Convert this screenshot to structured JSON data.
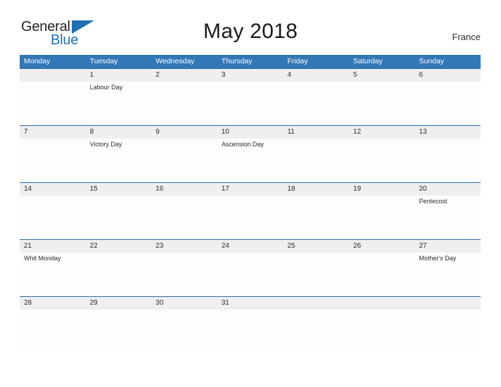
{
  "branding": {
    "name_part1": "General",
    "name_part2": "Blue",
    "flag_icon": "blue-triangle-flag-icon"
  },
  "header": {
    "title": "May 2018",
    "country": "France"
  },
  "colors": {
    "header_blue": "#3277b6",
    "rule_blue": "#2f6da8",
    "date_band_gray": "#efefef",
    "logo_blue": "#1f6fb2",
    "text_dark": "#2b2b2b"
  },
  "calendar": {
    "weekdays": [
      "Monday",
      "Tuesday",
      "Wednesday",
      "Thursday",
      "Friday",
      "Saturday",
      "Sunday"
    ],
    "weeks": [
      {
        "days": [
          {
            "date": "",
            "event": ""
          },
          {
            "date": "1",
            "event": "Labour Day"
          },
          {
            "date": "2",
            "event": ""
          },
          {
            "date": "3",
            "event": ""
          },
          {
            "date": "4",
            "event": ""
          },
          {
            "date": "5",
            "event": ""
          },
          {
            "date": "6",
            "event": ""
          }
        ]
      },
      {
        "days": [
          {
            "date": "7",
            "event": ""
          },
          {
            "date": "8",
            "event": "Victory Day"
          },
          {
            "date": "9",
            "event": ""
          },
          {
            "date": "10",
            "event": "Ascension Day"
          },
          {
            "date": "11",
            "event": ""
          },
          {
            "date": "12",
            "event": ""
          },
          {
            "date": "13",
            "event": ""
          }
        ]
      },
      {
        "days": [
          {
            "date": "14",
            "event": ""
          },
          {
            "date": "15",
            "event": ""
          },
          {
            "date": "16",
            "event": ""
          },
          {
            "date": "17",
            "event": ""
          },
          {
            "date": "18",
            "event": ""
          },
          {
            "date": "19",
            "event": ""
          },
          {
            "date": "20",
            "event": "Pentecost"
          }
        ]
      },
      {
        "days": [
          {
            "date": "21",
            "event": "Whit Monday"
          },
          {
            "date": "22",
            "event": ""
          },
          {
            "date": "23",
            "event": ""
          },
          {
            "date": "24",
            "event": ""
          },
          {
            "date": "25",
            "event": ""
          },
          {
            "date": "26",
            "event": ""
          },
          {
            "date": "27",
            "event": "Mother's Day"
          }
        ]
      },
      {
        "days": [
          {
            "date": "28",
            "event": ""
          },
          {
            "date": "29",
            "event": ""
          },
          {
            "date": "30",
            "event": ""
          },
          {
            "date": "31",
            "event": ""
          },
          {
            "date": "",
            "event": ""
          },
          {
            "date": "",
            "event": ""
          },
          {
            "date": "",
            "event": ""
          }
        ]
      }
    ]
  }
}
